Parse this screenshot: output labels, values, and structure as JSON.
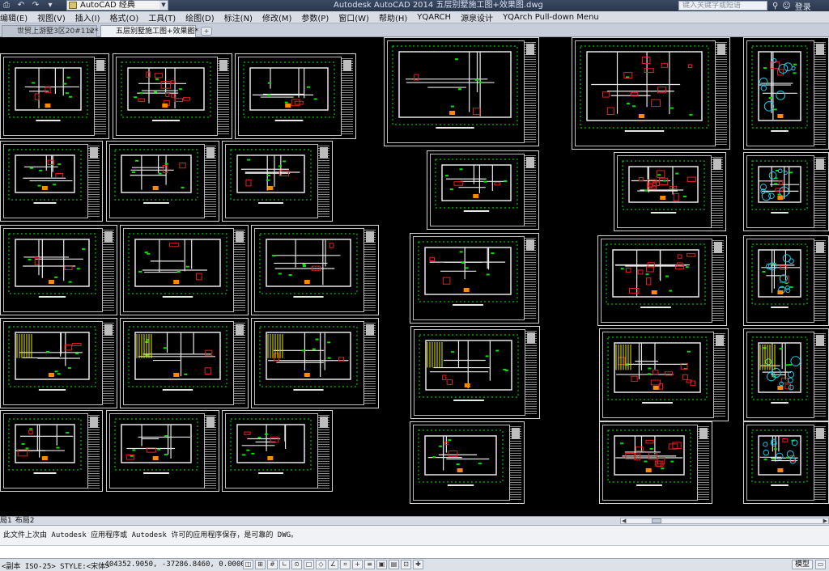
{
  "titlebar": {
    "workspace": "AutoCAD 经典",
    "app_title": "Autodesk AutoCAD 2014    五层别墅施工图+效果图.dwg",
    "search_placeholder": "键入关键字或短语",
    "login": "登录"
  },
  "menu": [
    "编辑(E)",
    "视图(V)",
    "插入(I)",
    "格式(O)",
    "工具(T)",
    "绘图(D)",
    "标注(N)",
    "修改(M)",
    "参数(P)",
    "窗口(W)",
    "帮助(H)",
    "YQARCH",
    "源泉设计",
    "YQArch Pull-down Menu"
  ],
  "tabs": [
    {
      "label": "世贸上游墅3区20#112*"
    },
    {
      "label": "五层别墅施工图+效果图*"
    }
  ],
  "layout_tabs": [
    "局1",
    "布局2"
  ],
  "command": {
    "message": "此文件上次由 Autodesk 应用程序或 Autodesk 许可的应用程序保存，是可靠的 DWG。"
  },
  "status": {
    "style": "<副本 ISO-25> STYLE:<宋体>",
    "coords": "-404352.9050, -37286.8460, 0.0000",
    "model": "模型"
  },
  "colors": {
    "walls": "#e8e8e8",
    "dimensions": "#00e600",
    "furniture_red": "#e81e1e",
    "cyan": "#1ec8e8",
    "yellow": "#e8e800",
    "orange": "#ff8a00"
  }
}
